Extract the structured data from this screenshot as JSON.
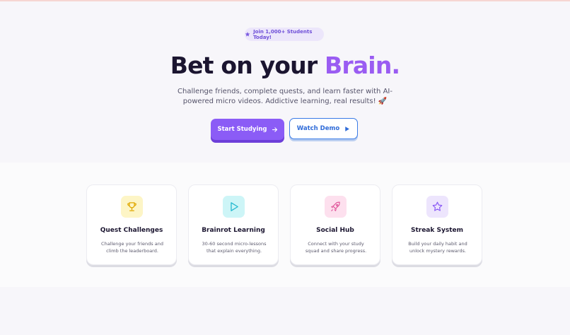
{
  "hero": {
    "badge_text": "Join 1,000+ Students Today!",
    "headline_prefix": "Bet on your ",
    "headline_accent": "Brain.",
    "subtext": "Challenge friends, complete quests, and learn faster with AI-powered micro videos. Addictive learning, real results! 🚀",
    "primary_button": "Start Studying",
    "secondary_button": "Watch Demo"
  },
  "features": [
    {
      "title": "Quest Challenges",
      "description": "Challenge your friends and climb the leaderboard.",
      "icon": "trophy-icon",
      "icon_color": "#e0a800",
      "icon_bg": "#fdf5c6"
    },
    {
      "title": "Brainrot Learning",
      "description": "30-60 second micro-lessons that explain everything.",
      "icon": "play-icon",
      "icon_color": "#22b8cf",
      "icon_bg": "#cdf5f7"
    },
    {
      "title": "Social Hub",
      "description": "Connect with your study squad and share progress.",
      "icon": "rocket-icon",
      "icon_color": "#e0569a",
      "icon_bg": "#fde0ee"
    },
    {
      "title": "Streak System",
      "description": "Build your daily habit and unlock mystery rewards.",
      "icon": "star-icon",
      "icon_color": "#8b5cf6",
      "icon_bg": "#ede5fd"
    }
  ],
  "colors": {
    "accent_purple": "#8b5cf6",
    "headline_accent": "#9a5cf2",
    "link_blue": "#2f6bd8"
  }
}
